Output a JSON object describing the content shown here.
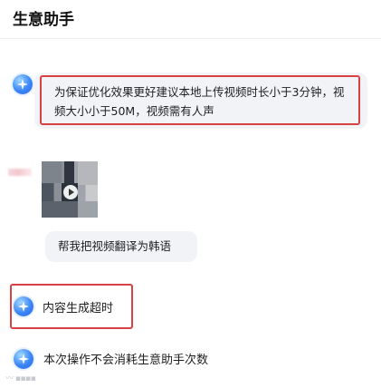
{
  "header": {
    "title": "生意助手"
  },
  "messages": {
    "bot_tip": "为保证优化效果更好建议本地上传视频时长小于3分钟，视频大小小于50M，视频需有人声",
    "user_request": "帮我把视频翻译为韩语",
    "status": "内容生成超时",
    "note": "本次操作不会消耗生意助手次数"
  },
  "icons": {
    "bot_avatar": "assistant-star-icon",
    "video_play": "play-icon"
  },
  "colors": {
    "bubble_bg": "#f1f3f7",
    "highlight_outline": "#d94242",
    "avatar_blue": "#3b86f7"
  }
}
